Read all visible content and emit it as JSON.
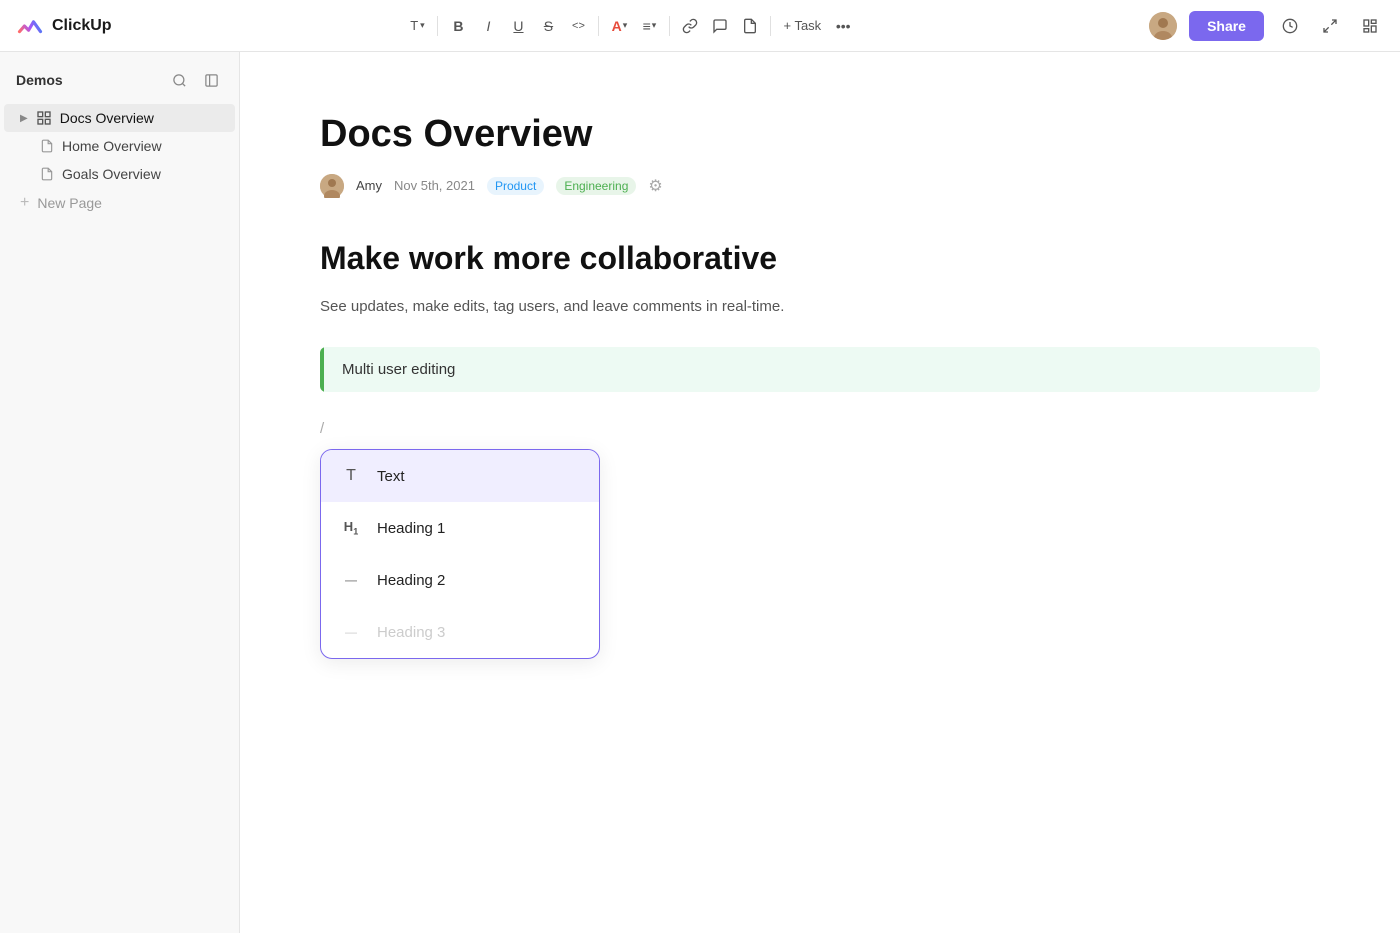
{
  "logo": {
    "text": "ClickUp"
  },
  "toolbar": {
    "text_format": "T",
    "bold": "B",
    "italic": "I",
    "underline": "U",
    "strikethrough": "S",
    "code": "<>",
    "color": "A",
    "align": "≡",
    "link": "🔗",
    "comment": "💬",
    "doc": "📄",
    "task": "+ Task",
    "more": "•••",
    "share_label": "Share",
    "history_icon": "🕐",
    "expand_icon": "↗",
    "layout_icon": "⊟"
  },
  "sidebar": {
    "workspace_title": "Demos",
    "search_tooltip": "Search",
    "collapse_tooltip": "Collapse",
    "items": [
      {
        "id": "docs-overview",
        "label": "Docs Overview",
        "icon": "grid",
        "active": true,
        "indent": 0,
        "has_arrow": true
      },
      {
        "id": "home-overview",
        "label": "Home Overview",
        "icon": "doc",
        "active": false,
        "indent": 1
      },
      {
        "id": "goals-overview",
        "label": "Goals Overview",
        "icon": "doc",
        "active": false,
        "indent": 1
      }
    ],
    "new_page_label": "New Page"
  },
  "document": {
    "title": "Docs Overview",
    "author": "Amy",
    "date": "Nov 5th, 2021",
    "tags": [
      {
        "label": "Product",
        "type": "product"
      },
      {
        "label": "Engineering",
        "type": "engineering"
      }
    ],
    "heading": "Make work more collaborative",
    "subtitle": "See updates, make edits, tag users, and leave comments in real-time.",
    "blockquote_text": "Multi user editing",
    "slash_placeholder": "/",
    "dropdown": {
      "items": [
        {
          "id": "text",
          "label": "Text",
          "icon_type": "T",
          "selected": true
        },
        {
          "id": "heading1",
          "label": "Heading 1",
          "icon_type": "H1"
        },
        {
          "id": "heading2",
          "label": "Heading 2",
          "icon_type": "H2"
        },
        {
          "id": "heading3",
          "label": "Heading 3",
          "icon_type": "H3"
        }
      ]
    }
  },
  "colors": {
    "accent": "#7b68ee",
    "green": "#4caf50",
    "blue": "#2196f3"
  }
}
